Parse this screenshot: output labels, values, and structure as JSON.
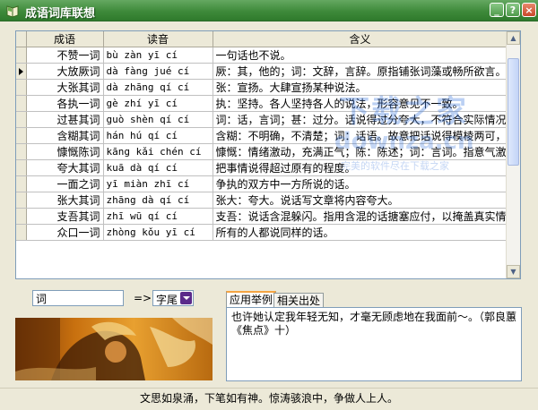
{
  "window": {
    "title": "成语词库联想",
    "min_label": "_",
    "help_label": "?",
    "close_label": "×"
  },
  "table": {
    "columns": [
      "成语",
      "读音",
      "含义"
    ],
    "rows": [
      {
        "idiom": "不赞一词",
        "pinyin": "bù zàn yī cí",
        "meaning": "一句话也不说。"
      },
      {
        "idiom": "大放厥词",
        "pinyin": "dà fàng jué cí",
        "meaning": "厥：其，他的；词：文辞，言辞。原指铺张词藻或畅所欲言。现用来指大"
      },
      {
        "idiom": "大张其词",
        "pinyin": "dà zhāng qí cí",
        "meaning": "张：宣扬。大肆宣扬某种说法。"
      },
      {
        "idiom": "各执一词",
        "pinyin": "gè zhí yī cí",
        "meaning": "执：坚持。各人坚持各人的说法，形容意见不一致。"
      },
      {
        "idiom": "过甚其词",
        "pinyin": "guò shèn qí cí",
        "meaning": "词：话，言词；甚：过分。话说得过分夸大，不符合实际情况。"
      },
      {
        "idiom": "含糊其词",
        "pinyin": "hán hú qí cí",
        "meaning": "含糊：不明确，不清楚；词：话语。故意把话说得模棱两可，不清楚，不"
      },
      {
        "idiom": "慷慨陈词",
        "pinyin": "kāng kǎi chén cí",
        "meaning": "慷慨：情绪激动，充满正气；陈：陈述；词：言词。指意气激昂地陈述自"
      },
      {
        "idiom": "夸大其词",
        "pinyin": "kuā dà qí cí",
        "meaning": "把事情说得超过原有的程度。"
      },
      {
        "idiom": "一面之词",
        "pinyin": "yī miàn zhī cí",
        "meaning": "争执的双方中一方所说的话。"
      },
      {
        "idiom": "张大其词",
        "pinyin": "zhāng dà qí cí",
        "meaning": "张大：夸大。说话写文章将内容夸大。"
      },
      {
        "idiom": "支吾其词",
        "pinyin": "zhī wū qí cí",
        "meaning": "支吾：说话含混躲闪。指用含混的话搪塞应付，以掩盖真实情况。"
      },
      {
        "idiom": "众口一词",
        "pinyin": "zhòng kǒu yī cí",
        "meaning": "所有的人都说同样的话。"
      }
    ],
    "selected_row": 1
  },
  "search": {
    "word": "词",
    "arrow": "=>",
    "position_option": "字尾"
  },
  "tabs": [
    "应用举例",
    "相关出处"
  ],
  "active_tab": 0,
  "example_text": "也许她认定我年轻无知，才毫无顾虑地在我面前～。（郭良蕙《焦点》十）",
  "status_text": "文思如泉涌，下笔如有神。惊涛骇浪中，争做人上人。",
  "watermark": {
    "line1": "下载之家",
    "line2": "downza.cn",
    "line3": "完美的软件尽在下载之家"
  }
}
